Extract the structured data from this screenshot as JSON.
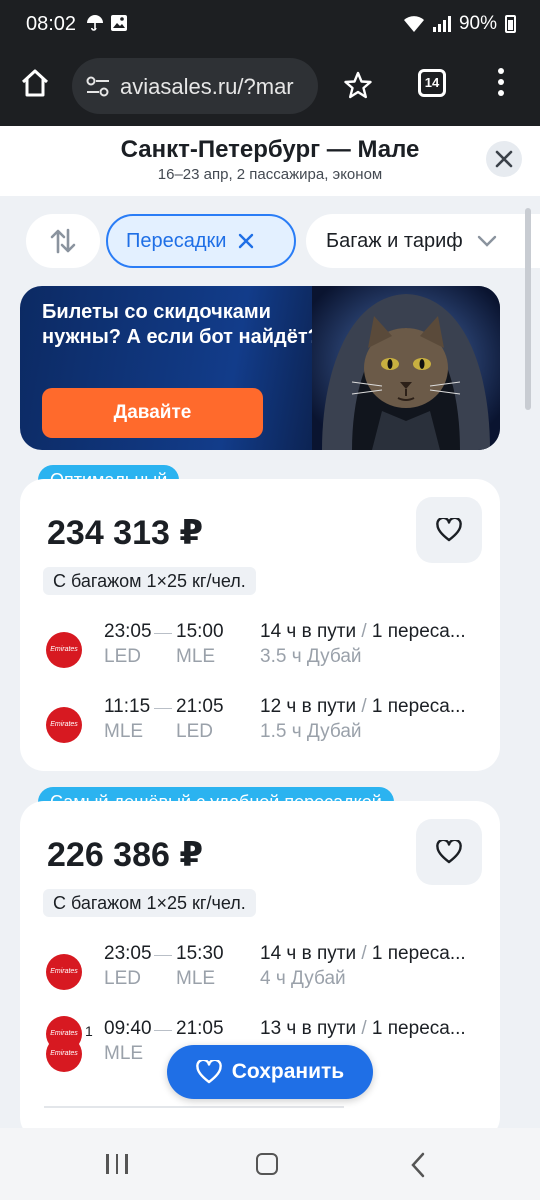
{
  "status_bar": {
    "time": "08:02",
    "battery": "90%"
  },
  "browser": {
    "url": "aviasales.ru/?mar",
    "tab_count": "14"
  },
  "header": {
    "title": "Санкт-Петербург — Мале",
    "subtitle": "16–23 апр, 2 пассажира, эконом"
  },
  "filters": {
    "transfers_label": "Пересадки",
    "baggage_label": "Багаж и тариф"
  },
  "banner": {
    "text": "Билеты со скидочками нужны? А если бот найдёт?",
    "cta": "Давайте"
  },
  "tickets": [
    {
      "badge": "Оптимальный",
      "price": "234 313 ₽",
      "baggage": "С багажом 1×25 кг/чел.",
      "airline": "Emirates",
      "segments": [
        {
          "dep_time": "23:05",
          "arr_time": "15:00",
          "dep_airport": "LED",
          "arr_airport": "MLE",
          "duration": "14 ч в пути",
          "separator": "/",
          "stops": "1 переса...",
          "layover": "3.5 ч Дубай"
        },
        {
          "dep_time": "11:15",
          "arr_time": "21:05",
          "dep_airport": "MLE",
          "arr_airport": "LED",
          "duration": "12 ч в пути",
          "separator": "/",
          "stops": "1 переса...",
          "layover": "1.5 ч Дубай"
        }
      ]
    },
    {
      "badge": "Самый дешёвый с удобной пересадкой",
      "price": "226 386 ₽",
      "baggage": "С багажом 1×25 кг/чел.",
      "airline": "Emirates",
      "segments": [
        {
          "dep_time": "23:05",
          "arr_time": "15:30",
          "dep_airport": "LED",
          "arr_airport": "MLE",
          "duration": "14 ч в пути",
          "separator": "/",
          "stops": "1 переса...",
          "layover": "4 ч Дубай"
        },
        {
          "dep_time": "09:40",
          "arr_time": "21:05",
          "dep_airport": "MLE",
          "arr_airport": "",
          "duration": "13 ч в пути",
          "separator": "/",
          "stops": "1 переса...",
          "layover": "",
          "airline_count": "1"
        }
      ]
    }
  ],
  "save_button": {
    "label": "Сохранить"
  },
  "colors": {
    "accent": "#1f6fe6",
    "badge": "#2bb3f0",
    "cta": "#ff6a2c",
    "emirates": "#d71921"
  }
}
